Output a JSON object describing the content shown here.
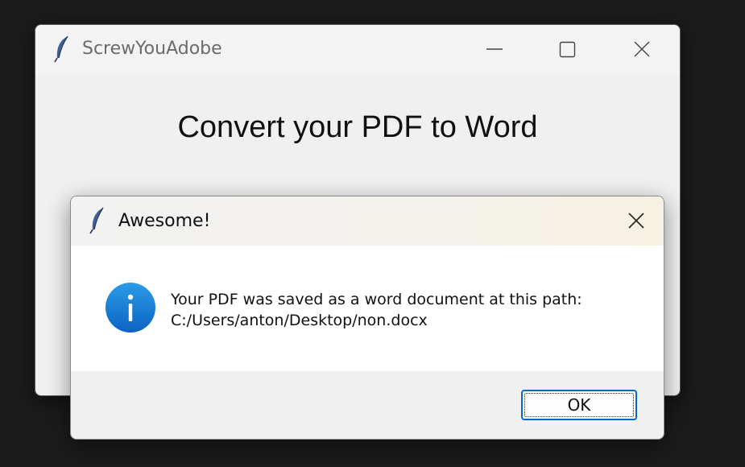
{
  "main_window": {
    "title": "ScrewYouAdobe",
    "icon": "feather-icon",
    "controls": [
      "minimize-icon",
      "maximize-icon",
      "close-icon"
    ],
    "heading": "Convert your PDF to Word"
  },
  "dialog": {
    "title": "Awesome!",
    "icon": "feather-icon",
    "info_icon": "info-icon",
    "message_line1": "Your PDF was saved as a word document at this path:",
    "message_line2": "C:/Users/anton/Desktop/non.docx",
    "ok_label": "OK"
  },
  "colors": {
    "background": "#1b1b1b",
    "window": "#f0f0f0",
    "info_blue": "#1a7fd6",
    "button_border": "#0a67c4"
  }
}
